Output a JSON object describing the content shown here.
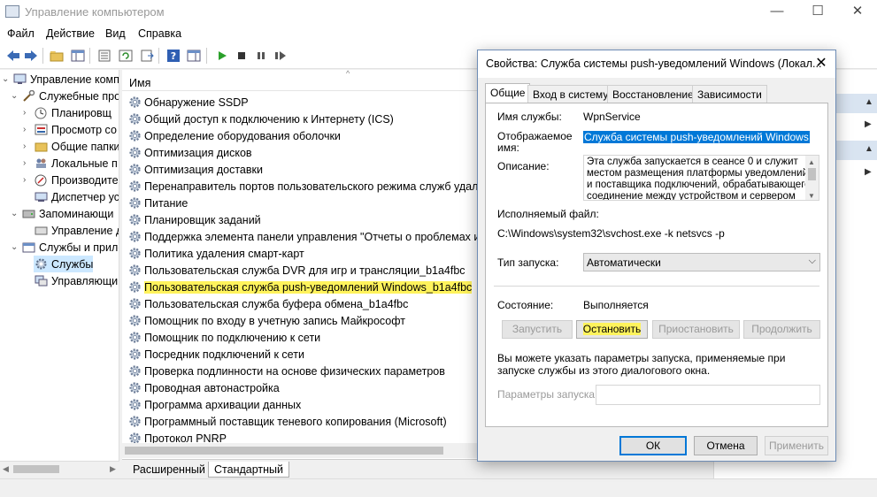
{
  "window": {
    "title": "Управление компьютером"
  },
  "menu": [
    "Файл",
    "Действие",
    "Вид",
    "Справка"
  ],
  "tree": {
    "items": [
      {
        "label": "Управление компь",
        "icon": "computer-management-icon",
        "arrow": "⌄"
      },
      {
        "label": "Служебные про",
        "icon": "tools-icon",
        "arrow": "⌄"
      },
      {
        "label": "Планировщ",
        "icon": "clock-icon",
        "arrow": "›"
      },
      {
        "label": "Просмотр со",
        "icon": "event-viewer-icon",
        "arrow": "›"
      },
      {
        "label": "Общие папки",
        "icon": "shared-folder-icon",
        "arrow": "›"
      },
      {
        "label": "Локальные п",
        "icon": "users-icon",
        "arrow": "›"
      },
      {
        "label": "Производите",
        "icon": "performance-icon",
        "arrow": "›"
      },
      {
        "label": "Диспетчер ус",
        "icon": "device-manager-icon",
        "arrow": ""
      },
      {
        "label": "Запоминающи",
        "icon": "storage-icon",
        "arrow": "⌄"
      },
      {
        "label": "Управление д",
        "icon": "disk-icon",
        "arrow": ""
      },
      {
        "label": "Службы и прило",
        "icon": "services-apps-icon",
        "arrow": "⌄"
      },
      {
        "label": "Службы",
        "icon": "services-icon",
        "arrow": ""
      },
      {
        "label": "Управляющий",
        "icon": "wmi-icon",
        "arrow": ""
      }
    ]
  },
  "list": {
    "header": "Имя",
    "rows": [
      "Обнаружение SSDP",
      "Общий доступ к подключению к Интернету (ICS)",
      "Определение оборудования оболочки",
      "Оптимизация дисков",
      "Оптимизация доставки",
      "Перенаправитель портов пользовательского режима служб удалени",
      "Питание",
      "Планировщик заданий",
      "Поддержка элемента панели управления \"Отчеты о проблемах и их",
      "Политика удаления смарт-карт",
      "Пользовательская служба DVR для игр и трансляции_b1a4fbc",
      "Пользовательская служба push-уведомлений Windows_b1a4fbc",
      "Пользовательская служба буфера обмена_b1a4fbc",
      "Помощник по входу в учетную запись Майкрософт",
      "Помощник по подключению к сети",
      "Посредник подключений к сети",
      "Проверка подлинности на основе физических параметров",
      "Проводная автонастройка",
      "Программа архивации данных",
      "Программный поставщик теневого копирования (Microsoft)",
      "Протокол PNRP"
    ],
    "highlighted_index": 11,
    "bottom_tabs": [
      "Расширенный",
      "Стандартный"
    ]
  },
  "dialog": {
    "title": "Свойства: Служба системы push-уведомлений Windows (Локал...",
    "tabs": [
      "Общие",
      "Вход в систему",
      "Восстановление",
      "Зависимости"
    ],
    "service_name_label": "Имя службы:",
    "service_name": "WpnService",
    "display_name_label_1": "Отображаемое",
    "display_name_label_2": "имя:",
    "display_name": "Служба системы push-уведомлений Windows",
    "description_label": "Описание:",
    "description": "Эта служба запускается в сеансе 0 и служит местом размещения платформы уведомлений и поставщика подключений, обрабатывающего соединение между устройством и сервером",
    "exe_label": "Исполняемый файл:",
    "exe_path": "C:\\Windows\\system32\\svchost.exe -k netsvcs -p",
    "startup_label": "Тип запуска:",
    "startup_value": "Автоматически",
    "status_label": "Состояние:",
    "status_value": "Выполняется",
    "buttons": {
      "start": "Запустить",
      "stop": "Остановить",
      "pause": "Приостановить",
      "resume": "Продолжить"
    },
    "hint": "Вы можете указать параметры запуска, применяемые при запуске службы из этого диалогового окна.",
    "params_label": "Параметры запуска:",
    "ok": "ОК",
    "cancel": "Отмена",
    "apply": "Применить"
  },
  "colors": {
    "highlight": "#fff35c",
    "selection": "#0078d7",
    "accent_border": "#6e8cb5"
  }
}
